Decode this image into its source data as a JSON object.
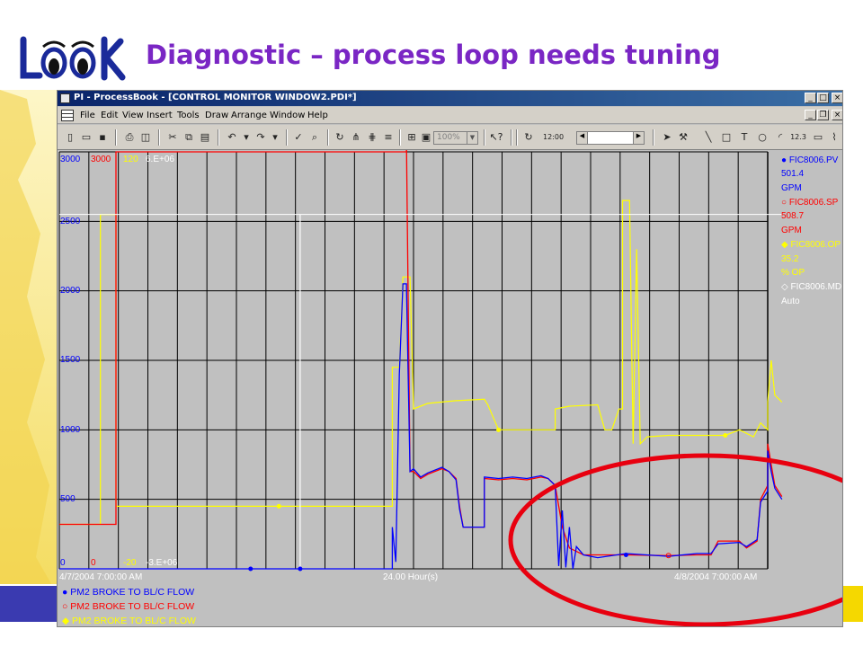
{
  "slide": {
    "title": "Diagnostic – process loop needs tuning",
    "logo_text": "LOOK"
  },
  "window": {
    "title": "PI - ProcessBook - [CONTROL MONITOR WINDOW2.PDI*]"
  },
  "menu": [
    "File",
    "Edit",
    "View",
    "Insert",
    "Tools",
    "Draw",
    "Arrange",
    "Window",
    "Help"
  ],
  "toolbar": {
    "zoom": "100%",
    "time_button": "12:00",
    "text_tool": "T",
    "number_tool": "12.3"
  },
  "trend": {
    "scales": {
      "pv": {
        "top": "3000",
        "bottom": "0",
        "color": "#0000ff"
      },
      "sp": {
        "top": "3000",
        "bottom": "0",
        "color": "#ff0000"
      },
      "op": {
        "top": "120",
        "bottom": "-20",
        "color": "#ffff00"
      },
      "md": {
        "top": "6.E+06",
        "bottom": "-3.E+06",
        "color": "#ffffff"
      }
    },
    "y_ticks": [
      "2500",
      "2000",
      "1500",
      "1000",
      "500"
    ],
    "time_start": "4/7/2004 7:00:00 AM",
    "time_span": "24.00 Hour(s)",
    "time_end": "4/8/2004 7:00:00 AM",
    "legend": [
      {
        "tag": "FIC8006.PV",
        "value": "501.4",
        "unit": "GPM",
        "color": "#0000ff"
      },
      {
        "tag": "FIC8006.SP",
        "value": "508.7",
        "unit": "GPM",
        "color": "#ff0000"
      },
      {
        "tag": "FIC8006.OP",
        "value": "35.2",
        "unit": "% OP",
        "color": "#ffff00"
      },
      {
        "tag": "FIC8006.MD",
        "value": "Auto",
        "unit": "",
        "color": "#ffffff"
      }
    ],
    "bottom_legend": [
      {
        "label": "PM2 BROKE TO BL/C FLOW",
        "color": "#0000ff"
      },
      {
        "label": "PM2 BROKE TO BL/C FLOW",
        "color": "#ff0000"
      },
      {
        "label": "PM2 BROKE TO BL/C FLOW",
        "color": "#ffff00"
      }
    ]
  },
  "colors": {
    "title": "#7a26c4",
    "annotation": "#e8000f",
    "plot_bg": "#c0c0c0",
    "grid": "#000000"
  }
}
